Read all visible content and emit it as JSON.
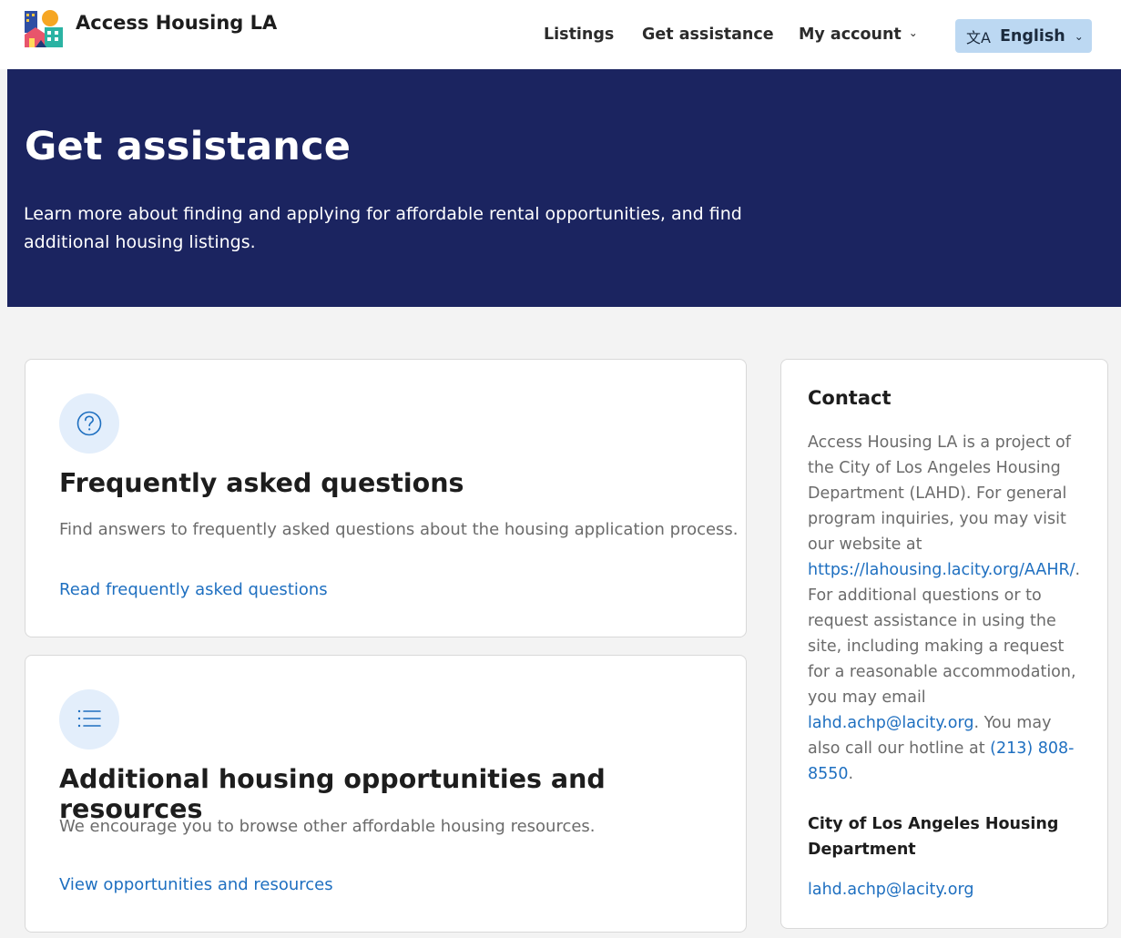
{
  "header": {
    "brand_name": "Access Housing LA",
    "nav": {
      "listings": "Listings",
      "get_assistance": "Get assistance",
      "my_account": "My account"
    },
    "language": {
      "selected": "English",
      "icon": "translate-icon"
    }
  },
  "hero": {
    "title": "Get assistance",
    "subtitle": "Learn more about finding and applying for affordable rental opportunities, and find additional housing listings."
  },
  "cards": [
    {
      "icon": "question-circle-icon",
      "title": "Frequently asked questions",
      "description": "Find answers to frequently asked questions about the housing application process.",
      "link": "Read frequently asked questions"
    },
    {
      "icon": "list-icon",
      "title": "Additional housing opportunities and resources",
      "description": "We encourage you to browse other affordable housing resources.",
      "link": "View opportunities and resources"
    }
  ],
  "contact": {
    "title": "Contact",
    "body_part1": "Access Housing LA is a project of the City of Los Angeles Housing Department (LAHD). For general program inquiries, you may visit our website at ",
    "website_link": "https://lahousing.lacity.org/AAHR/",
    "body_part2": ". For additional questions or to request assistance in using the site, including making a request for a reasonable accommodation, you may email ",
    "email_link_inline": "lahd.achp@lacity.org",
    "body_part3": ". You may also call our hotline at ",
    "phone_link": "(213) 808-8550",
    "body_part4": ".",
    "org_name": "City of Los Angeles Housing Department",
    "email": "lahd.achp@lacity.org"
  },
  "colors": {
    "hero_bg": "#1b2460",
    "link": "#1e6fc0",
    "language_button_bg": "#bcd8f2",
    "icon_circle_bg": "#e3eefb"
  }
}
